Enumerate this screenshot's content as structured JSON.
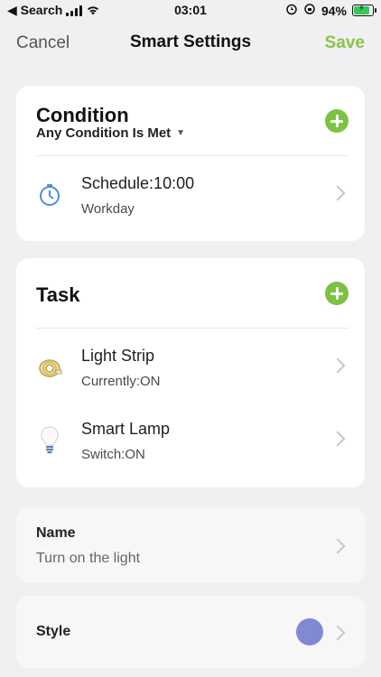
{
  "status": {
    "back_label": "◀ Search",
    "time": "03:01",
    "battery": "94%",
    "battery_level": 0.94
  },
  "nav": {
    "cancel": "Cancel",
    "title": "Smart Settings",
    "save": "Save"
  },
  "condition": {
    "title": "Condition",
    "mode": "Any Condition Is Met",
    "items": [
      {
        "label": "Schedule:10:00",
        "sub": "Workday",
        "icon": "timer-icon"
      }
    ]
  },
  "task": {
    "title": "Task",
    "items": [
      {
        "label": "Light Strip",
        "sub": "Currently:ON",
        "icon": "light-strip-icon"
      },
      {
        "label": "Smart Lamp",
        "sub": "Switch:ON",
        "icon": "bulb-icon"
      }
    ]
  },
  "name_section": {
    "title": "Name",
    "value": "Turn on the light"
  },
  "style_section": {
    "title": "Style",
    "color": "#8089d2"
  },
  "colors": {
    "accent_green": "#8bc34a",
    "add_button_green": "#7cc243"
  }
}
